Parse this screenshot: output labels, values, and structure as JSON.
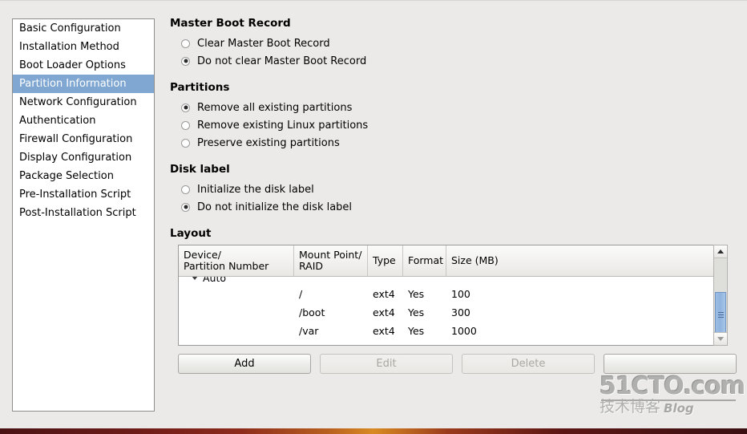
{
  "sidebar": {
    "items": [
      {
        "label": "Basic Configuration",
        "selected": false
      },
      {
        "label": "Installation Method",
        "selected": false
      },
      {
        "label": "Boot Loader Options",
        "selected": false
      },
      {
        "label": "Partition Information",
        "selected": true
      },
      {
        "label": "Network Configuration",
        "selected": false
      },
      {
        "label": "Authentication",
        "selected": false
      },
      {
        "label": "Firewall Configuration",
        "selected": false
      },
      {
        "label": "Display Configuration",
        "selected": false
      },
      {
        "label": "Package Selection",
        "selected": false
      },
      {
        "label": "Pre-Installation Script",
        "selected": false
      },
      {
        "label": "Post-Installation Script",
        "selected": false
      }
    ]
  },
  "sections": {
    "mbr": {
      "title": "Master Boot Record",
      "options": [
        {
          "label": "Clear Master Boot Record",
          "checked": false
        },
        {
          "label": "Do not clear Master Boot Record",
          "checked": true
        }
      ]
    },
    "partitions": {
      "title": "Partitions",
      "options": [
        {
          "label": "Remove all existing partitions",
          "checked": true
        },
        {
          "label": "Remove existing Linux partitions",
          "checked": false
        },
        {
          "label": "Preserve existing partitions",
          "checked": false
        }
      ]
    },
    "disk_label": {
      "title": "Disk label",
      "options": [
        {
          "label": "Initialize the disk label",
          "checked": false
        },
        {
          "label": "Do not initialize the disk label",
          "checked": true
        }
      ]
    },
    "layout": {
      "title": "Layout",
      "columns": [
        "Device/\nPartition Number",
        "Mount Point/\nRAID",
        "Type",
        "Format",
        "Size (MB)"
      ],
      "columns_flat": {
        "device_line1": "Device/",
        "device_line2": "Partition Number",
        "mount_line1": "Mount Point/",
        "mount_line2": "RAID",
        "type": "Type",
        "format": "Format",
        "size": "Size (MB)"
      },
      "rows": [
        {
          "device": "Auto",
          "mount": "",
          "type": "",
          "format": "",
          "size": "",
          "group": true,
          "expanded": true
        },
        {
          "device": "",
          "mount": "/",
          "type": "ext4",
          "format": "Yes",
          "size": "100",
          "group": false
        },
        {
          "device": "",
          "mount": "/boot",
          "type": "ext4",
          "format": "Yes",
          "size": "300",
          "group": false
        },
        {
          "device": "",
          "mount": "/var",
          "type": "ext4",
          "format": "Yes",
          "size": "1000",
          "group": false
        }
      ]
    }
  },
  "buttons": [
    {
      "label": "Add",
      "enabled": true
    },
    {
      "label": "Edit",
      "enabled": false
    },
    {
      "label": "Delete",
      "enabled": false
    },
    {
      "label": "",
      "enabled": true
    }
  ],
  "watermark": {
    "main": "51CTO.com",
    "cn": "技术博客",
    "blog": "Blog"
  },
  "colors": {
    "window_bg": "#ebeae8",
    "list_bg": "#ffffff",
    "selection_bg": "#7fa7d2",
    "selection_fg": "#ffffff",
    "scrollbar_thumb": "#8fb3de",
    "border": "#9a9a9a"
  }
}
